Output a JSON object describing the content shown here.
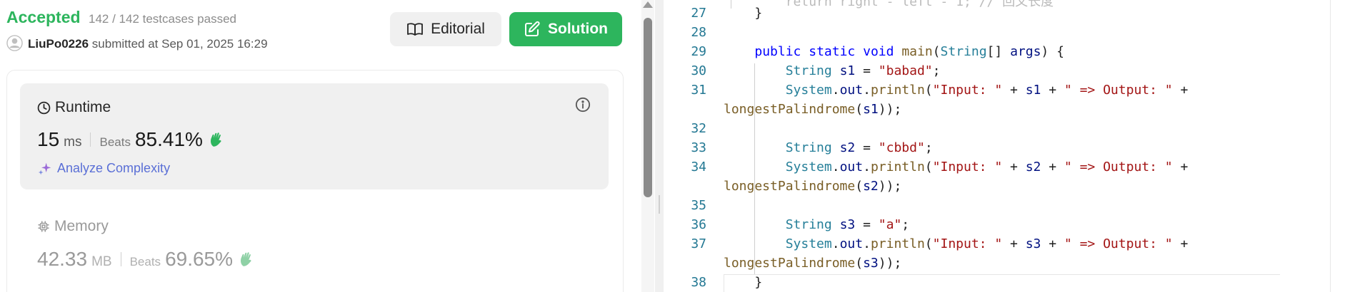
{
  "submission": {
    "status": "Accepted",
    "tests": "142 / 142 testcases passed",
    "username": "LiuPo0226",
    "submitted_text": "submitted at Sep 01, 2025 16:29"
  },
  "buttons": {
    "editorial": "Editorial",
    "solution": "Solution"
  },
  "runtime": {
    "title": "Runtime",
    "value": "15",
    "unit": "ms",
    "beats_label": "Beats",
    "beats_pct": "85.41%",
    "analyze_label": "Analyze Complexity"
  },
  "memory": {
    "title": "Memory",
    "value": "42.33",
    "unit": "MB",
    "beats_label": "Beats",
    "beats_pct": "69.65%"
  },
  "icons": {
    "editorial": "book-open-icon",
    "solution": "edit-icon",
    "runtime": "clock-icon",
    "info": "info-icon",
    "analyze": "sparkle-icon",
    "memory": "chip-icon",
    "beats": "waving-hand-icon"
  },
  "colors": {
    "accepted": "#2db55d",
    "solution_button": "#2db55d",
    "link": "#5a6fd6"
  },
  "editor": {
    "lines": [
      {
        "num": "27",
        "text": "    }"
      },
      {
        "num": "28",
        "text": ""
      },
      {
        "num": "29",
        "text": "    public static void main(String[] args) {"
      },
      {
        "num": "30",
        "text": "        String s1 = \"babad\";"
      },
      {
        "num": "31",
        "text": "        System.out.println(\"Input: \" + s1 + \" => Output: \" +"
      },
      {
        "num": "",
        "text": "longestPalindrome(s1));"
      },
      {
        "num": "32",
        "text": ""
      },
      {
        "num": "33",
        "text": "        String s2 = \"cbbd\";"
      },
      {
        "num": "34",
        "text": "        System.out.println(\"Input: \" + s2 + \" => Output: \" +"
      },
      {
        "num": "",
        "text": "longestPalindrome(s2));"
      },
      {
        "num": "35",
        "text": ""
      },
      {
        "num": "36",
        "text": "        String s3 = \"a\";"
      },
      {
        "num": "37",
        "text": "        System.out.println(\"Input: \" + s3 + \" => Output: \" +"
      },
      {
        "num": "",
        "text": "longestPalindrome(s3));"
      },
      {
        "num": "38",
        "text": "    }"
      }
    ]
  }
}
